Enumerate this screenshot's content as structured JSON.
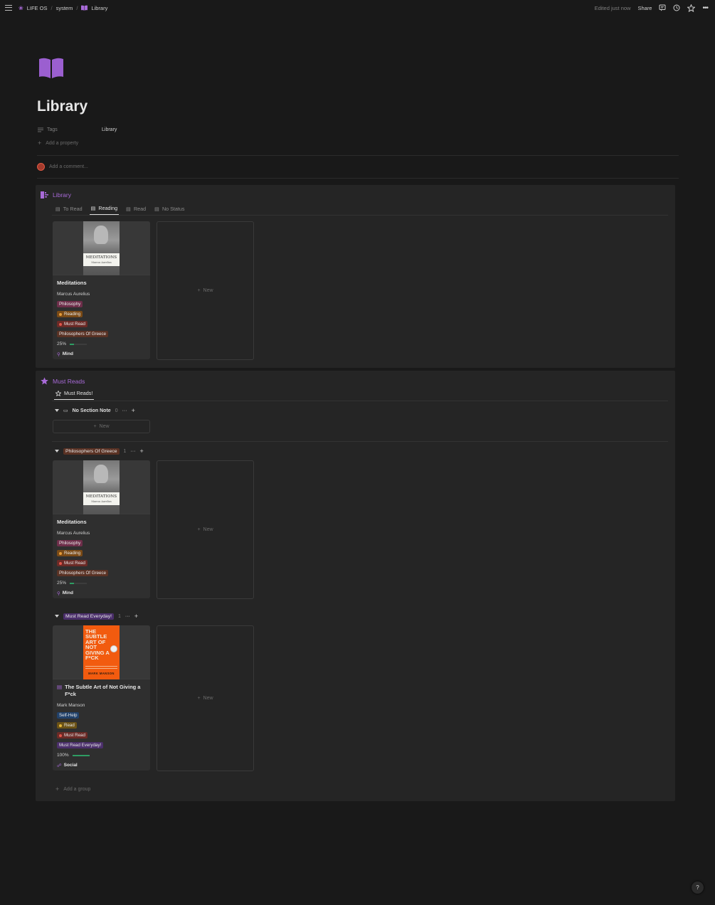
{
  "breadcrumb": [
    "LIFE OS",
    "system",
    "Library"
  ],
  "topbar": {
    "edited": "Edited just now",
    "share": "Share"
  },
  "page": {
    "title": "Library"
  },
  "properties": {
    "tags_label": "Tags",
    "tags_value": "Library",
    "add_property": "Add a property"
  },
  "comment": {
    "placeholder": "Add a comment..."
  },
  "library_db": {
    "title": "Library",
    "tabs": [
      {
        "label": "To Read",
        "active": false
      },
      {
        "label": "Reading",
        "active": true
      },
      {
        "label": "Read",
        "active": false
      },
      {
        "label": "No Status",
        "active": false
      }
    ],
    "new_label": "New"
  },
  "must_reads_db": {
    "title": "Must Reads",
    "tab": "Must Reads!",
    "new_label": "New",
    "add_group": "Add a group",
    "groups": [
      {
        "name": "No Section Note",
        "count": "0"
      },
      {
        "name": "Philosophers Of Greece",
        "count": "1"
      },
      {
        "name": "Must Read Everyday!",
        "count": "1"
      }
    ]
  },
  "books": {
    "meditations": {
      "title": "Meditations",
      "cover_title": "MEDITATIONS",
      "cover_author": "Marcus Aurelius",
      "author": "Marcus Aurelius",
      "genre": "Philosophy",
      "status": "Reading",
      "priority": "Must Read",
      "collection": "Philosophers Of Greece",
      "progress_label": "25%",
      "progress": 0.25,
      "area": "Mind"
    },
    "subtle_art": {
      "title": "The Subtle Art of Not Giving a F*ck",
      "cover_title": "THE SUBTLE ART OF NOT GIVING A F*CK",
      "cover_author": "MARK MANSON",
      "author": "Mark Manson",
      "genre": "Self-Help",
      "status": "Read",
      "priority": "Must Read",
      "collection": "Must Read Everyday!",
      "progress_label": "100%",
      "progress": 1.0,
      "area": "Social"
    }
  },
  "help": "?",
  "colors": {
    "accent": "#a86ad8",
    "philosophy": "#6e2e4a",
    "reading": "#7a4a16",
    "must_read": "#6b2a26",
    "philosophers": "#5a3224",
    "selfhelp": "#21416a",
    "read": "#6b5216",
    "everyday": "#4b2f6b",
    "progress": "#2e9c63"
  }
}
